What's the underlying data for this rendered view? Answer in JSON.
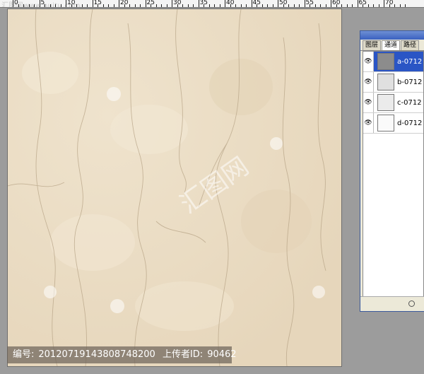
{
  "ruler": {
    "watermark": "汇图网www.huitu.com",
    "labels": [
      "0",
      "5",
      "10",
      "15",
      "20",
      "25",
      "30",
      "35",
      "40",
      "45",
      "50",
      "55",
      "60",
      "65",
      "70"
    ]
  },
  "canvas": {
    "watermark_text": "汇图网",
    "background_color": "#ecdfc7"
  },
  "caption": {
    "id_label": "编号:",
    "id_value": "20120719143808748200",
    "uploader_label": "上传者ID:",
    "uploader_value": "90462"
  },
  "panel": {
    "tabs": [
      "图层",
      "通道",
      "路径"
    ],
    "active_tab_index": 1,
    "channels": [
      {
        "name": "a-0712",
        "selected": true,
        "thumb_color": "#8c8c8c"
      },
      {
        "name": "b-0712",
        "selected": false,
        "thumb_color": "#e0e0e0"
      },
      {
        "name": "c-0712",
        "selected": false,
        "thumb_color": "#ebebeb"
      },
      {
        "name": "d-0712",
        "selected": false,
        "thumb_color": "#fafafa"
      }
    ],
    "eye_icon": "eye-icon"
  }
}
